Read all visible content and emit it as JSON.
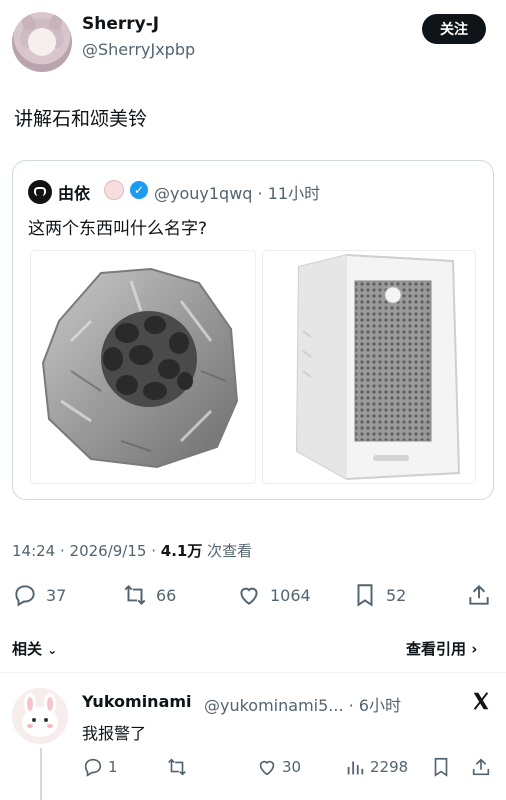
{
  "tweet": {
    "display_name": "Sherry-J",
    "handle": "@SherryJxpbp",
    "follow_label": "关注",
    "text": "讲解石和颂美铃",
    "timestamp": "14:24 · 2026/9/15 ·",
    "views_count": "4.1万",
    "views_label": "次查看"
  },
  "quote": {
    "name": "由依",
    "handle_time": "@youy1qwq · 11小时",
    "text": "这两个东西叫什么名字?"
  },
  "actions": {
    "replies": "37",
    "retweets": "66",
    "likes": "1064",
    "bookmarks": "52"
  },
  "related_label": "相关",
  "see_quotes_label": "查看引用",
  "reply": {
    "name": "Yukominami",
    "handle_time": "@yukominami5... · 6小时",
    "text": "我报警了",
    "replies": "1",
    "retweets": "",
    "likes": "30",
    "views": "2298"
  },
  "icons": [
    "reply-icon",
    "retweet-icon",
    "like-icon",
    "bookmark-icon",
    "share-icon",
    "x-logo-icon",
    "views-icon",
    "verified-icon",
    "chevron-down-icon",
    "chevron-right-icon"
  ],
  "colors": {
    "accent": "#1d9bf0",
    "text": "#0f1419",
    "muted": "#536471"
  }
}
